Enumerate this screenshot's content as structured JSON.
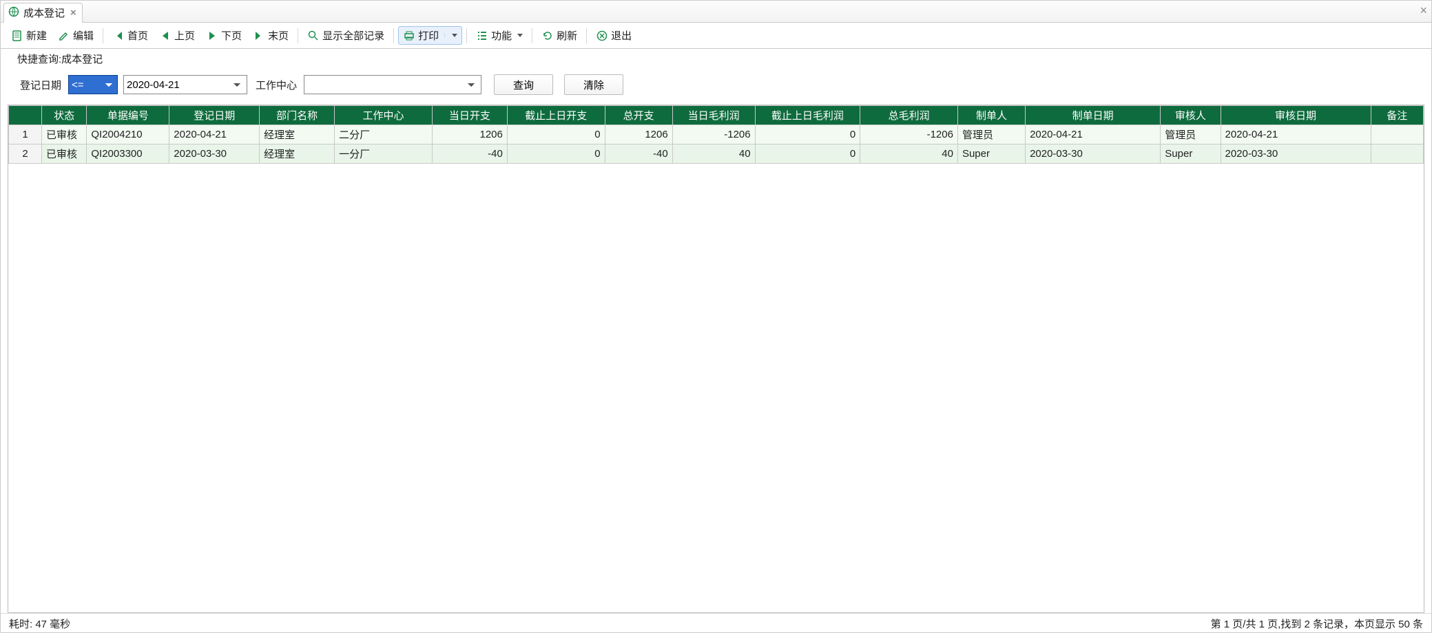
{
  "tab": {
    "title": "成本登记"
  },
  "toolbar": {
    "new": "新建",
    "edit": "编辑",
    "first": "首页",
    "prev": "上页",
    "next": "下页",
    "last": "末页",
    "showall": "显示全部记录",
    "print": "打印",
    "func": "功能",
    "refresh": "刷新",
    "exit": "退出"
  },
  "quick": {
    "title": "快捷查询:成本登记",
    "date_label": "登记日期",
    "op_value": "<=",
    "date_value": "2020-04-21",
    "wc_label": "工作中心",
    "wc_value": "",
    "query_btn": "查询",
    "clear_btn": "清除"
  },
  "grid": {
    "headers": {
      "rownum": "",
      "status": "状态",
      "billno": "单据编号",
      "date": "登记日期",
      "dept": "部门名称",
      "wc": "工作中心",
      "dayexp": "当日开支",
      "prevexp": "截止上日开支",
      "totexp": "总开支",
      "dayprof": "当日毛利润",
      "prevprof": "截止上日毛利润",
      "totprof": "总毛利润",
      "maker": "制单人",
      "mdate": "制单日期",
      "auditor": "审核人",
      "adate": "审核日期",
      "remark": "备注"
    },
    "rows": [
      {
        "n": "1",
        "status": "已审核",
        "billno": "QI2004210",
        "date": "2020-04-21",
        "dept": "经理室",
        "wc": "二分厂",
        "dayexp": "1206",
        "prevexp": "0",
        "totexp": "1206",
        "dayprof": "-1206",
        "prevprof": "0",
        "totprof": "-1206",
        "maker": "管理员",
        "mdate": "2020-04-21",
        "auditor": "管理员",
        "adate": "2020-04-21",
        "remark": ""
      },
      {
        "n": "2",
        "status": "已审核",
        "billno": "QI2003300",
        "date": "2020-03-30",
        "dept": "经理室",
        "wc": "一分厂",
        "dayexp": "-40",
        "prevexp": "0",
        "totexp": "-40",
        "dayprof": "40",
        "prevprof": "0",
        "totprof": "40",
        "maker": "Super",
        "mdate": "2020-03-30",
        "auditor": "Super",
        "adate": "2020-03-30",
        "remark": ""
      }
    ]
  },
  "status": {
    "left": "耗时: 47 毫秒",
    "right": "第 1 页/共 1 页,找到 2 条记录，本页显示 50 条"
  }
}
